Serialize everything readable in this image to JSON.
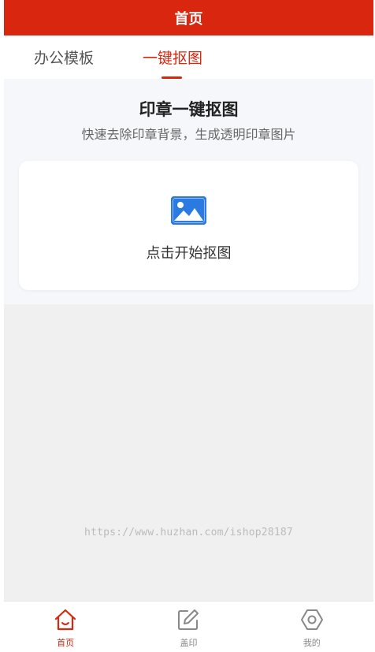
{
  "header": {
    "title": "首页"
  },
  "tabs": [
    {
      "label": "办公模板",
      "active": false
    },
    {
      "label": "一键抠图",
      "active": true
    }
  ],
  "main": {
    "title": "印章一键抠图",
    "subtitle": "快速去除印章背景，生成透明印章图片",
    "upload_card": {
      "label": "点击开始抠图",
      "icon": "image-icon"
    }
  },
  "watermark": "https://www.huzhan.com/ishop28187",
  "bottom_nav": [
    {
      "label": "首页",
      "icon": "home-icon",
      "active": true
    },
    {
      "label": "盖印",
      "icon": "edit-icon",
      "active": false
    },
    {
      "label": "我的",
      "icon": "settings-icon",
      "active": false
    }
  ],
  "colors": {
    "accent": "#d9270f",
    "icon_blue": "#2a7ae2",
    "page_bg": "#f0f0f0"
  }
}
